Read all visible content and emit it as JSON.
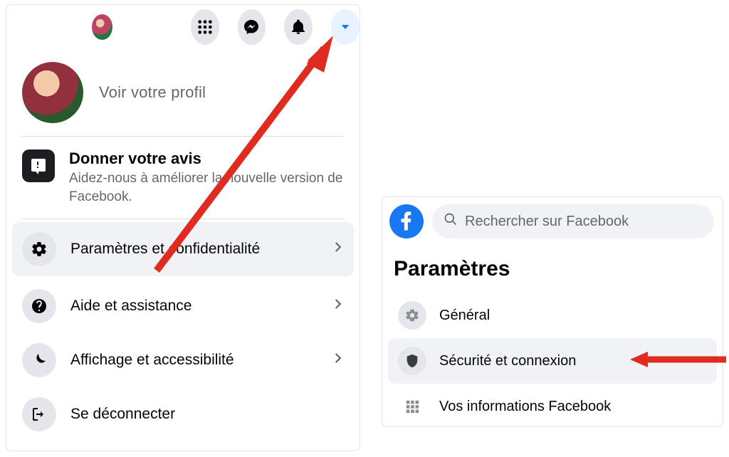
{
  "colors": {
    "accent": "#1877f2",
    "arrow": "#e02b20"
  },
  "dropdown": {
    "profile_link": "Voir votre profil",
    "feedback": {
      "title": "Donner votre avis",
      "subtitle": "Aidez-nous à améliorer la nouvelle version de Facebook."
    },
    "items": [
      {
        "label": "Paramètres et confidentialité",
        "icon": "gear",
        "chevron": true,
        "selected": true
      },
      {
        "label": "Aide et assistance",
        "icon": "help",
        "chevron": true,
        "selected": false
      },
      {
        "label": "Affichage et accessibilité",
        "icon": "moon",
        "chevron": true,
        "selected": false
      },
      {
        "label": "Se déconnecter",
        "icon": "logout",
        "chevron": false,
        "selected": false
      }
    ]
  },
  "settings_panel": {
    "search_placeholder": "Rechercher sur Facebook",
    "title": "Paramètres",
    "items": [
      {
        "label": "Général",
        "icon": "gear-grey",
        "selected": false
      },
      {
        "label": "Sécurité et connexion",
        "icon": "shield",
        "selected": true
      },
      {
        "label": "Vos informations Facebook",
        "icon": "grid-dots",
        "selected": false
      }
    ]
  }
}
